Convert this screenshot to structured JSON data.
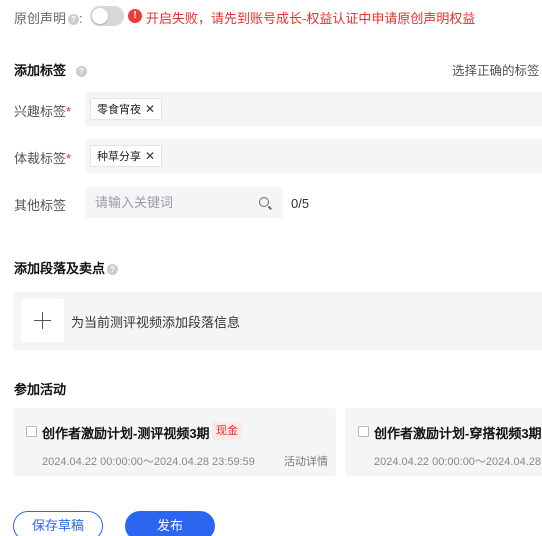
{
  "original": {
    "label": "原创声明",
    "colon": ":",
    "warning": "开启失败，请先到账号成长-权益认证中申请原创声明权益"
  },
  "tags_section": {
    "title": "添加标签",
    "hint": "选择正确的标签",
    "interest": {
      "label": "兴趣标签",
      "required_mark": "*",
      "tag": "零食宵夜"
    },
    "genre": {
      "label": "体裁标签",
      "required_mark": "*",
      "tag": "种草分享"
    },
    "other": {
      "label": "其他标签",
      "placeholder": "请输入关键词",
      "counter": "0/5"
    }
  },
  "paragraph_section": {
    "title": "添加段落及卖点",
    "add_text": "为当前测评视频添加段落信息"
  },
  "activity_section": {
    "title": "参加活动",
    "cards": [
      {
        "title": "创作者激励计划-测评视频3期",
        "badge": "现金",
        "date": "2024.04.22 00:00:00～2024.04.28 23:59:59",
        "link": "活动详情"
      },
      {
        "title": "创作者激励计划-穿搭视频3期",
        "badge": "",
        "date": "2024.04.22 00:00:00～2024.04.28",
        "link": ""
      }
    ]
  },
  "actions": {
    "save_label": "保存草稿",
    "publish_label": "发布"
  },
  "colors": {
    "accent": "#2c66f0",
    "error": "#e8302f",
    "panel_bg": "#f4f5f7"
  }
}
